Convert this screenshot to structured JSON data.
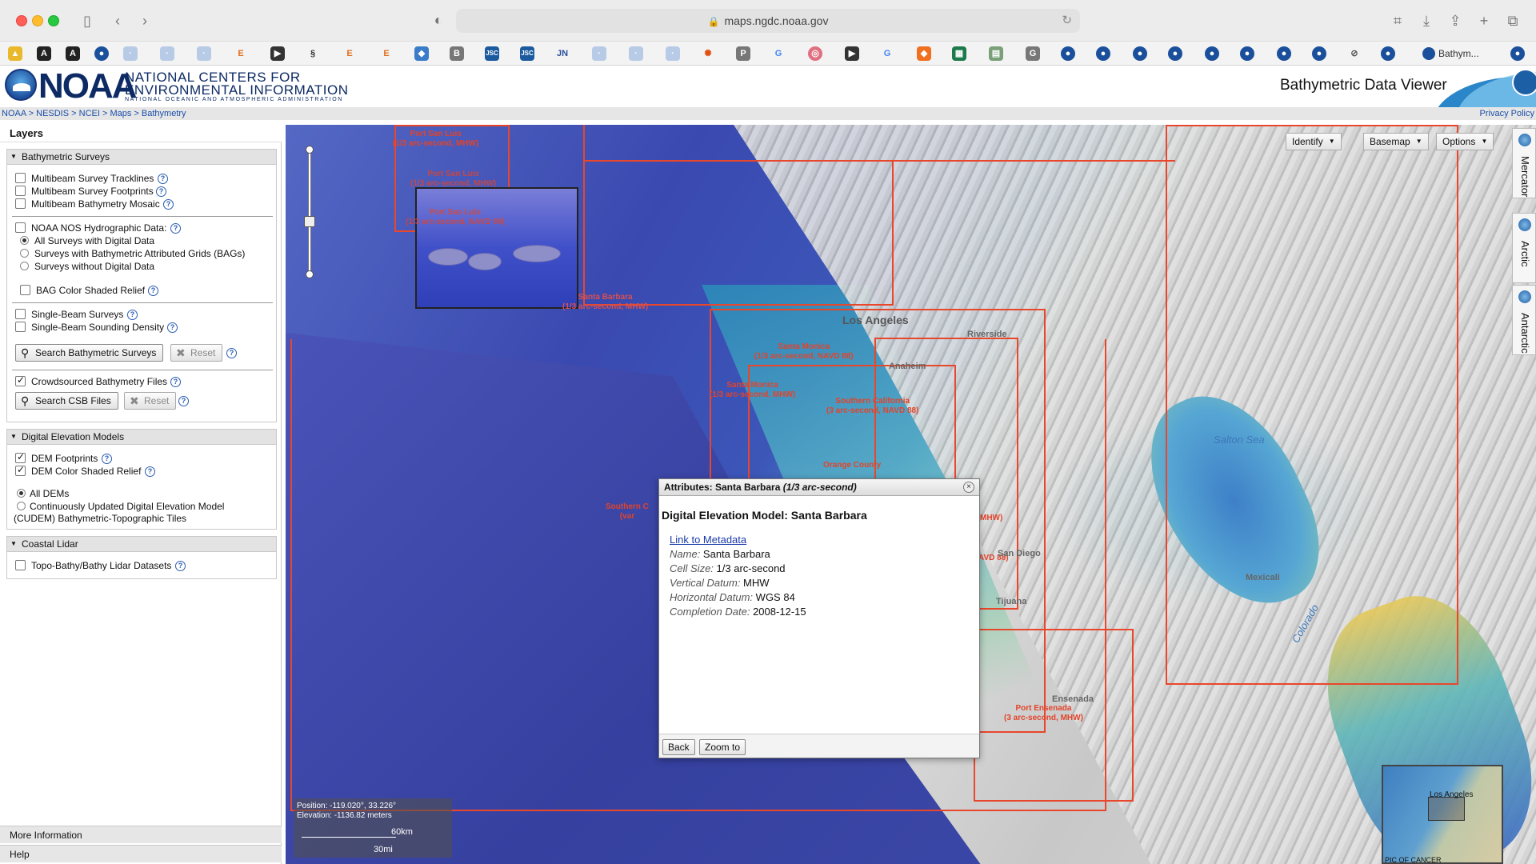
{
  "browser": {
    "url": "maps.ngdc.noaa.gov",
    "active_tab_label": "Bathym..."
  },
  "header": {
    "logo_text": "NOAA",
    "org_line1": "NATIONAL CENTERS FOR",
    "org_line2": "ENVIRONMENTAL INFORMATION",
    "org_line3": "NATIONAL OCEANIC AND ATMOSPHERIC ADMINISTRATION",
    "app_title": "Bathymetric Data Viewer"
  },
  "breadcrumb": {
    "items": [
      "NOAA",
      "NESDIS",
      "NCEI",
      "Maps",
      "Bathymetry"
    ],
    "separator": " > ",
    "privacy": "Privacy Policy"
  },
  "layers": {
    "title": "Layers",
    "bathymetric_surveys": {
      "heading": "Bathymetric Surveys",
      "multibeam_tracklines": "Multibeam Survey Tracklines",
      "multibeam_footprints": "Multibeam Survey Footprints",
      "multibeam_mosaic": "Multibeam Bathymetry Mosaic",
      "nos_hydro": "NOAA NOS Hydrographic Data:",
      "all_surveys": "All Surveys with Digital Data",
      "bag_surveys": "Surveys with Bathymetric Attributed Grids (BAGs)",
      "no_digital": "Surveys without Digital Data",
      "bag_relief": "BAG Color Shaded Relief",
      "single_beam": "Single-Beam Surveys",
      "single_beam_density": "Single-Beam Sounding Density",
      "search_button": "Search Bathymetric Surveys",
      "reset_button": "Reset",
      "csb_files": "Crowdsourced Bathymetry Files",
      "search_csb_button": "Search CSB Files",
      "reset_csb_button": "Reset"
    },
    "dem": {
      "heading": "Digital Elevation Models",
      "footprints": "DEM Footprints",
      "relief": "DEM Color Shaded Relief",
      "all_dems": "All DEMs",
      "cudem_line1": "Continuously Updated Digital Elevation Model",
      "cudem_line2": "(CUDEM) Bathymetric-Topographic Tiles"
    },
    "lidar": {
      "heading": "Coastal Lidar",
      "topo_bathy": "Topo-Bathy/Bathy Lidar Datasets"
    },
    "more_info": "More Information",
    "help": "Help"
  },
  "map": {
    "toolbar": {
      "identify": "Identify",
      "basemap": "Basemap",
      "options": "Options"
    },
    "projections": [
      "Mercator",
      "Arctic",
      "Antarctic"
    ],
    "dem_labels": [
      {
        "name": "Port San Luis",
        "detail": "(1/3 arc-second, MHW)"
      },
      {
        "name": "Port San Luis",
        "detail": "(1/3 arc-second, MHW)"
      },
      {
        "name": "Port San Luis",
        "detail": "(1/3 arc-second, NAVD 88)"
      },
      {
        "name": "Santa Barbara",
        "detail": "(1/3 arc-second, MHW)"
      },
      {
        "name": "Santa Monica",
        "detail": "(1/3 arc-second, NAVD 88)"
      },
      {
        "name": "Santa Monica",
        "detail": "(1/3 arc-second, MHW)"
      },
      {
        "name": "Southern California",
        "detail": "(3 arc-second, NAVD 88)"
      },
      {
        "name": "Orange County",
        "detail": ""
      },
      {
        "name": "Southern C",
        "detail": "(var"
      },
      {
        "name": "Port Ensenada",
        "detail": "(3 arc-second, MHW)"
      }
    ],
    "partial_labels": [
      "MHW)",
      "AVD 88)"
    ],
    "places": [
      "Los Angeles",
      "Riverside",
      "Anaheim",
      "Salton Sea",
      "Mexicali",
      "Colorado",
      "San Diego",
      "Tijuana",
      "Ensenada"
    ],
    "position": {
      "line1": "Position: -119.020°, 33.226°",
      "line2": "Elevation: -1136.82 meters",
      "scale_km": "60km",
      "scale_mi": "30mi"
    },
    "overview": {
      "city": "Los Angeles",
      "tropic": "PIC OF CANCER"
    }
  },
  "popup": {
    "title_prefix": "Attributes: Santa Barbara ",
    "title_italic": "(1/3 arc-second)",
    "heading": "Digital Elevation Model: Santa Barbara",
    "metadata_link": "Link to Metadata",
    "attributes": [
      {
        "key": "Name:",
        "value": "Santa Barbara"
      },
      {
        "key": "Cell Size:",
        "value": "1/3 arc-second"
      },
      {
        "key": "Vertical Datum:",
        "value": "MHW"
      },
      {
        "key": "Horizontal Datum:",
        "value": "WGS 84"
      },
      {
        "key": "Completion Date:",
        "value": "2008-12-15"
      }
    ],
    "back_button": "Back",
    "zoom_button": "Zoom to"
  }
}
